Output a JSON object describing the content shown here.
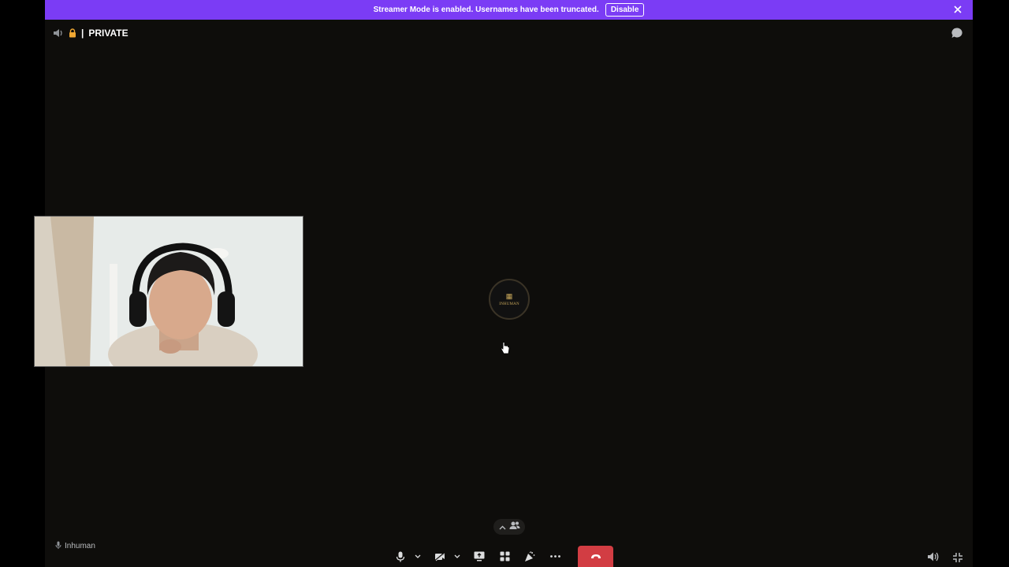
{
  "banner": {
    "text": "Streamer Mode is enabled. Usernames have been truncated.",
    "button_label": "Disable",
    "color": "#7b3cf5"
  },
  "channel": {
    "separator": "|",
    "name": "PRIVATE",
    "icons": [
      "speaker-icon",
      "lock-icon"
    ]
  },
  "user": {
    "name": "Inhuman"
  },
  "avatar": {
    "logo_text": "INHUMAN"
  },
  "controls": {
    "items": [
      "microphone-icon",
      "chevron-down-icon",
      "camera-off-icon",
      "chevron-down-icon",
      "screen-share-icon",
      "activities-icon",
      "soundboard-icon",
      "more-icon",
      "hang-up-icon"
    ],
    "hangup_color": "#d23d43"
  }
}
